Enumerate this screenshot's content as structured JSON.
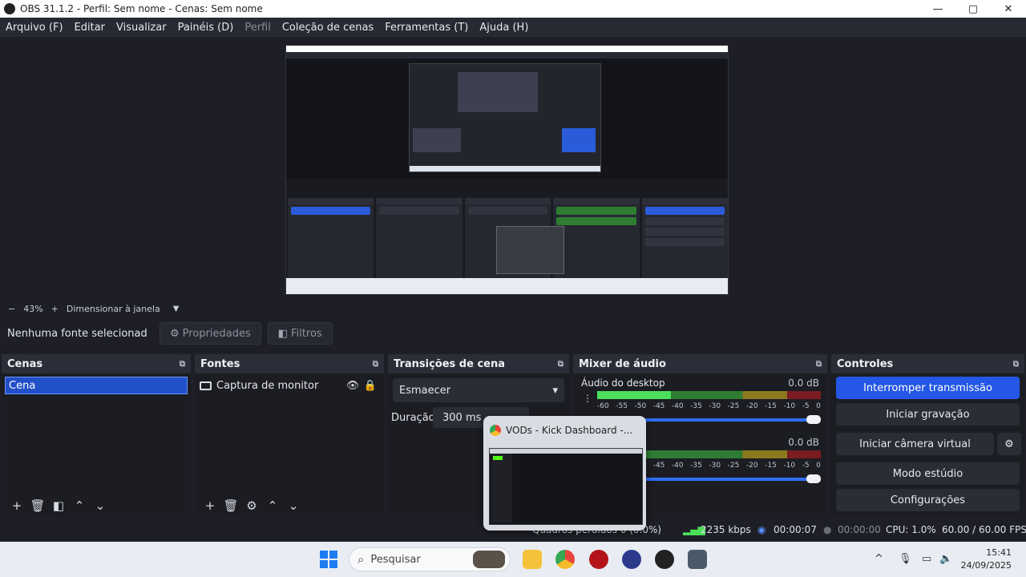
{
  "window": {
    "title": "OBS 31.1.2 - Perfil: Sem nome - Cenas: Sem nome",
    "minimize": "—",
    "maximize": "▢",
    "close": "✕"
  },
  "menu": {
    "items": [
      {
        "label": "Arquivo (F)",
        "enabled": true
      },
      {
        "label": "Editar",
        "enabled": true
      },
      {
        "label": "Visualizar",
        "enabled": true
      },
      {
        "label": "Painéis (D)",
        "enabled": true
      },
      {
        "label": "Perfil",
        "enabled": false
      },
      {
        "label": "Coleção de cenas",
        "enabled": true
      },
      {
        "label": "Ferramentas (T)",
        "enabled": true
      },
      {
        "label": "Ajuda (H)",
        "enabled": true
      }
    ]
  },
  "zoom": {
    "minus": "−",
    "value": "43%",
    "plus": "+",
    "scale_mode": "Dimensionar à janela",
    "caret": "▼"
  },
  "source_toolbar": {
    "no_source": "Nenhuma fonte selecionad",
    "properties": "Propriedades",
    "filters": "Filtros",
    "properties_icon": "gear-icon",
    "filters_icon": "filter-icon"
  },
  "scenes": {
    "title": "Cenas",
    "items": [
      "Cena"
    ],
    "selected": "Cena"
  },
  "sources": {
    "title": "Fontes",
    "items": [
      {
        "label": "Captura de monitor",
        "visible": true,
        "locked": true
      }
    ]
  },
  "transitions": {
    "title": "Transições de cena",
    "selected": "Esmaecer",
    "duration_label": "Duração",
    "duration_value": "300 ms"
  },
  "mixer": {
    "title": "Mixer de áudio",
    "scale": [
      "-60",
      "-55",
      "-50",
      "-45",
      "-40",
      "-35",
      "-30",
      "-25",
      "-20",
      "-15",
      "-10",
      "-5",
      "0"
    ],
    "tracks": [
      {
        "name": "Áudio do desktop",
        "db": "0.0 dB",
        "level": 0.33
      },
      {
        "name": "",
        "db": "0.0 dB",
        "level": 0.0
      }
    ]
  },
  "controls": {
    "title": "Controles",
    "stop_stream": "Interromper transmissão",
    "start_recording": "Iniciar gravação",
    "start_virtual_cam": "Iniciar câmera virtual",
    "studio_mode": "Modo estúdio",
    "settings": "Configurações"
  },
  "status": {
    "dropped_frames": "Quadros perdidos 0 (0.0%)",
    "bitrate": "2235 kbps",
    "stream_time": "00:00:07",
    "rec_time": "00:00:00",
    "cpu": "CPU: 1.0%",
    "fps": "60.00 / 60.00 FPS"
  },
  "popup": {
    "title": "VODs - Kick Dashboard -..."
  },
  "taskbar": {
    "search_placeholder": "Pesquisar",
    "time": "15:41",
    "date": "24/09/2025",
    "tray_chevron": "^",
    "accent": "#1d7cf2"
  },
  "nested_preview": {
    "title": "OBS 31.1.2 - Perfil: Sem nome - Cenas: Sem nome"
  }
}
